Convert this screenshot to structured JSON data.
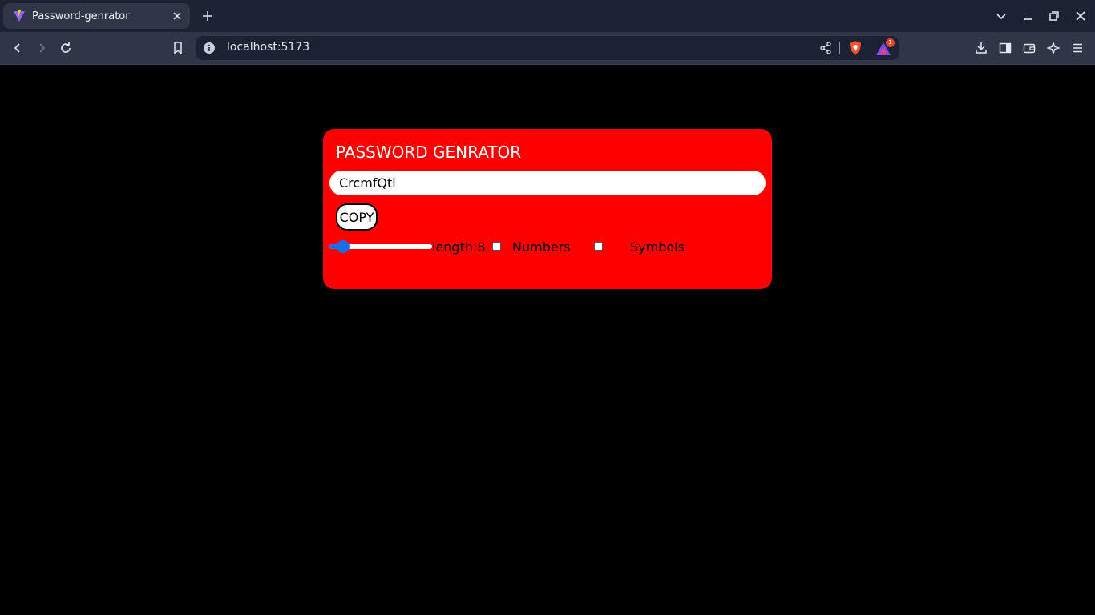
{
  "browser": {
    "tab": {
      "title": "Password-genrator"
    },
    "address_bar": {
      "url": "localhost:5173"
    },
    "rewards_badge": "1",
    "colors": {
      "tabbar_bg": "#1b2233",
      "toolbar_bg": "#2f3647"
    }
  },
  "app": {
    "title": "PASSWORD GENRATOR",
    "password_value": "CrcmfQtl",
    "copy_label": "COPY",
    "length": {
      "label": "length:8",
      "value": 8,
      "min": 6,
      "max": 30
    },
    "options": {
      "numbers": {
        "label": "Numbers",
        "checked": false
      },
      "symbols": {
        "label": "Symbols",
        "checked": false
      }
    },
    "colors": {
      "page_bg": "#000000",
      "card_bg": "#ff0000",
      "slider_accent": "#1a6fe8"
    }
  }
}
